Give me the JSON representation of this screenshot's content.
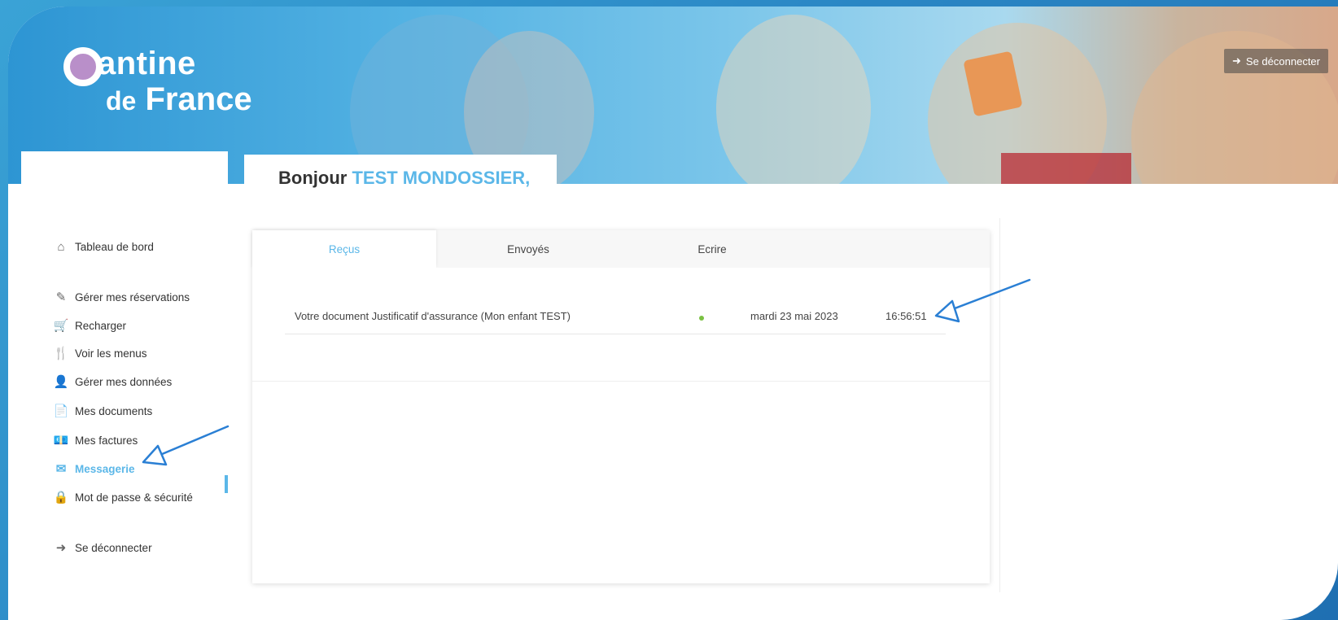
{
  "brand": {
    "line1": "antine",
    "line2_prefix": "de",
    "line2": "France"
  },
  "header": {
    "logout_label": "Se déconnecter"
  },
  "greeting": {
    "prefix": "Bonjour",
    "name": "TEST MONDOSSIER,"
  },
  "sidebar": {
    "items": [
      {
        "label": "Tableau de bord",
        "icon": "home-icon"
      },
      {
        "label": "Gérer mes réservations",
        "icon": "edit-icon"
      },
      {
        "label": "Recharger",
        "icon": "cart-icon"
      },
      {
        "label": "Voir les menus",
        "icon": "cutlery-icon"
      },
      {
        "label": "Gérer mes données",
        "icon": "user-icon"
      },
      {
        "label": "Mes documents",
        "icon": "document-icon"
      },
      {
        "label": "Mes factures",
        "icon": "invoice-icon"
      },
      {
        "label": "Messagerie",
        "icon": "mail-icon",
        "active": true
      },
      {
        "label": "Mot de passe & sécurité",
        "icon": "lock-icon"
      },
      {
        "label": "Se déconnecter",
        "icon": "logout-icon"
      }
    ]
  },
  "tabs": [
    {
      "label": "Reçus",
      "active": true
    },
    {
      "label": "Envoyés"
    },
    {
      "label": "Ecrire"
    }
  ],
  "messages": [
    {
      "subject": "Votre document Justificatif d'assurance (Mon enfant TEST)",
      "status": "unread",
      "date": "mardi 23 mai 2023",
      "time": "16:56:51"
    }
  ],
  "colors": {
    "accent": "#5bb7e8",
    "arrow": "#2a7fd4",
    "status_dot": "#7ac142"
  }
}
